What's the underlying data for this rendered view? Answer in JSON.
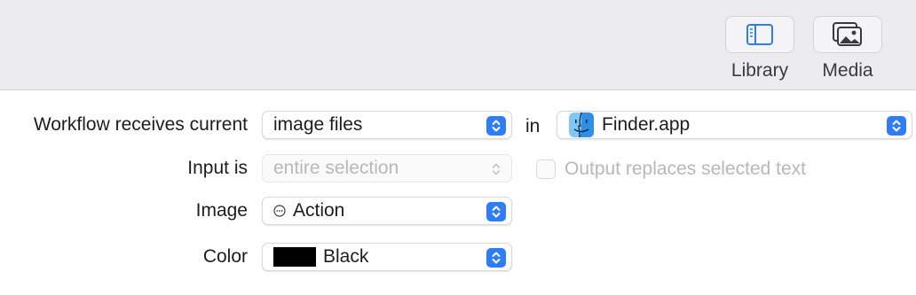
{
  "toolbar": {
    "library_label": "Library",
    "media_label": "Media"
  },
  "form": {
    "receives_label": "Workflow receives current",
    "receives_value": "image files",
    "in_label": "in",
    "app_value": "Finder.app",
    "input_label": "Input is",
    "input_value": "entire selection",
    "output_replaces_label": "Output replaces selected text",
    "output_replaces_checked": false,
    "image_label": "Image",
    "image_value": "Action",
    "color_label": "Color",
    "color_value": "Black",
    "color_swatch": "#000000"
  },
  "colors": {
    "accent": "#2e7cf6",
    "toolbar_bg": "#ecebee",
    "disabled_text": "#b8b8bb"
  },
  "icons": {
    "library": "sidebar-icon",
    "media": "photos-icon",
    "finder": "finder-icon",
    "action": "ellipsis-circle-icon",
    "stepper": "up-down-chevron-icon"
  }
}
